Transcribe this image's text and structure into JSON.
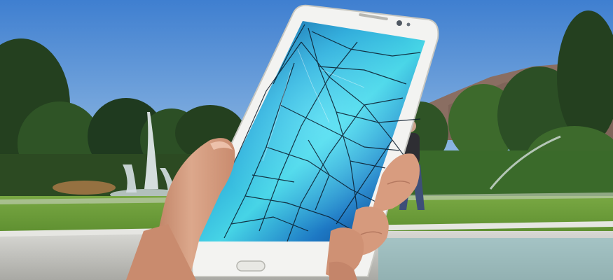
{
  "scene": {
    "subject": "hand-holding-cracked-smartphone",
    "colors": {
      "sky_top": "#3f7fd0",
      "sky_bottom": "#a9cbe8",
      "mountain": "#8a6e62",
      "foliage_dark": "#1f3a1f",
      "foliage_mid": "#3d6a2c",
      "lawn": "#6fa03a",
      "phone_frame": "#f3f3f1",
      "screen_blue": "#1a6fc8",
      "screen_cyan": "#3fd0e0",
      "crack": "#0a1a2a",
      "skin": "#d9a184",
      "skin_shadow": "#b4785f",
      "fountain": "#e8eef2",
      "wall": "#c9c9c5"
    }
  }
}
